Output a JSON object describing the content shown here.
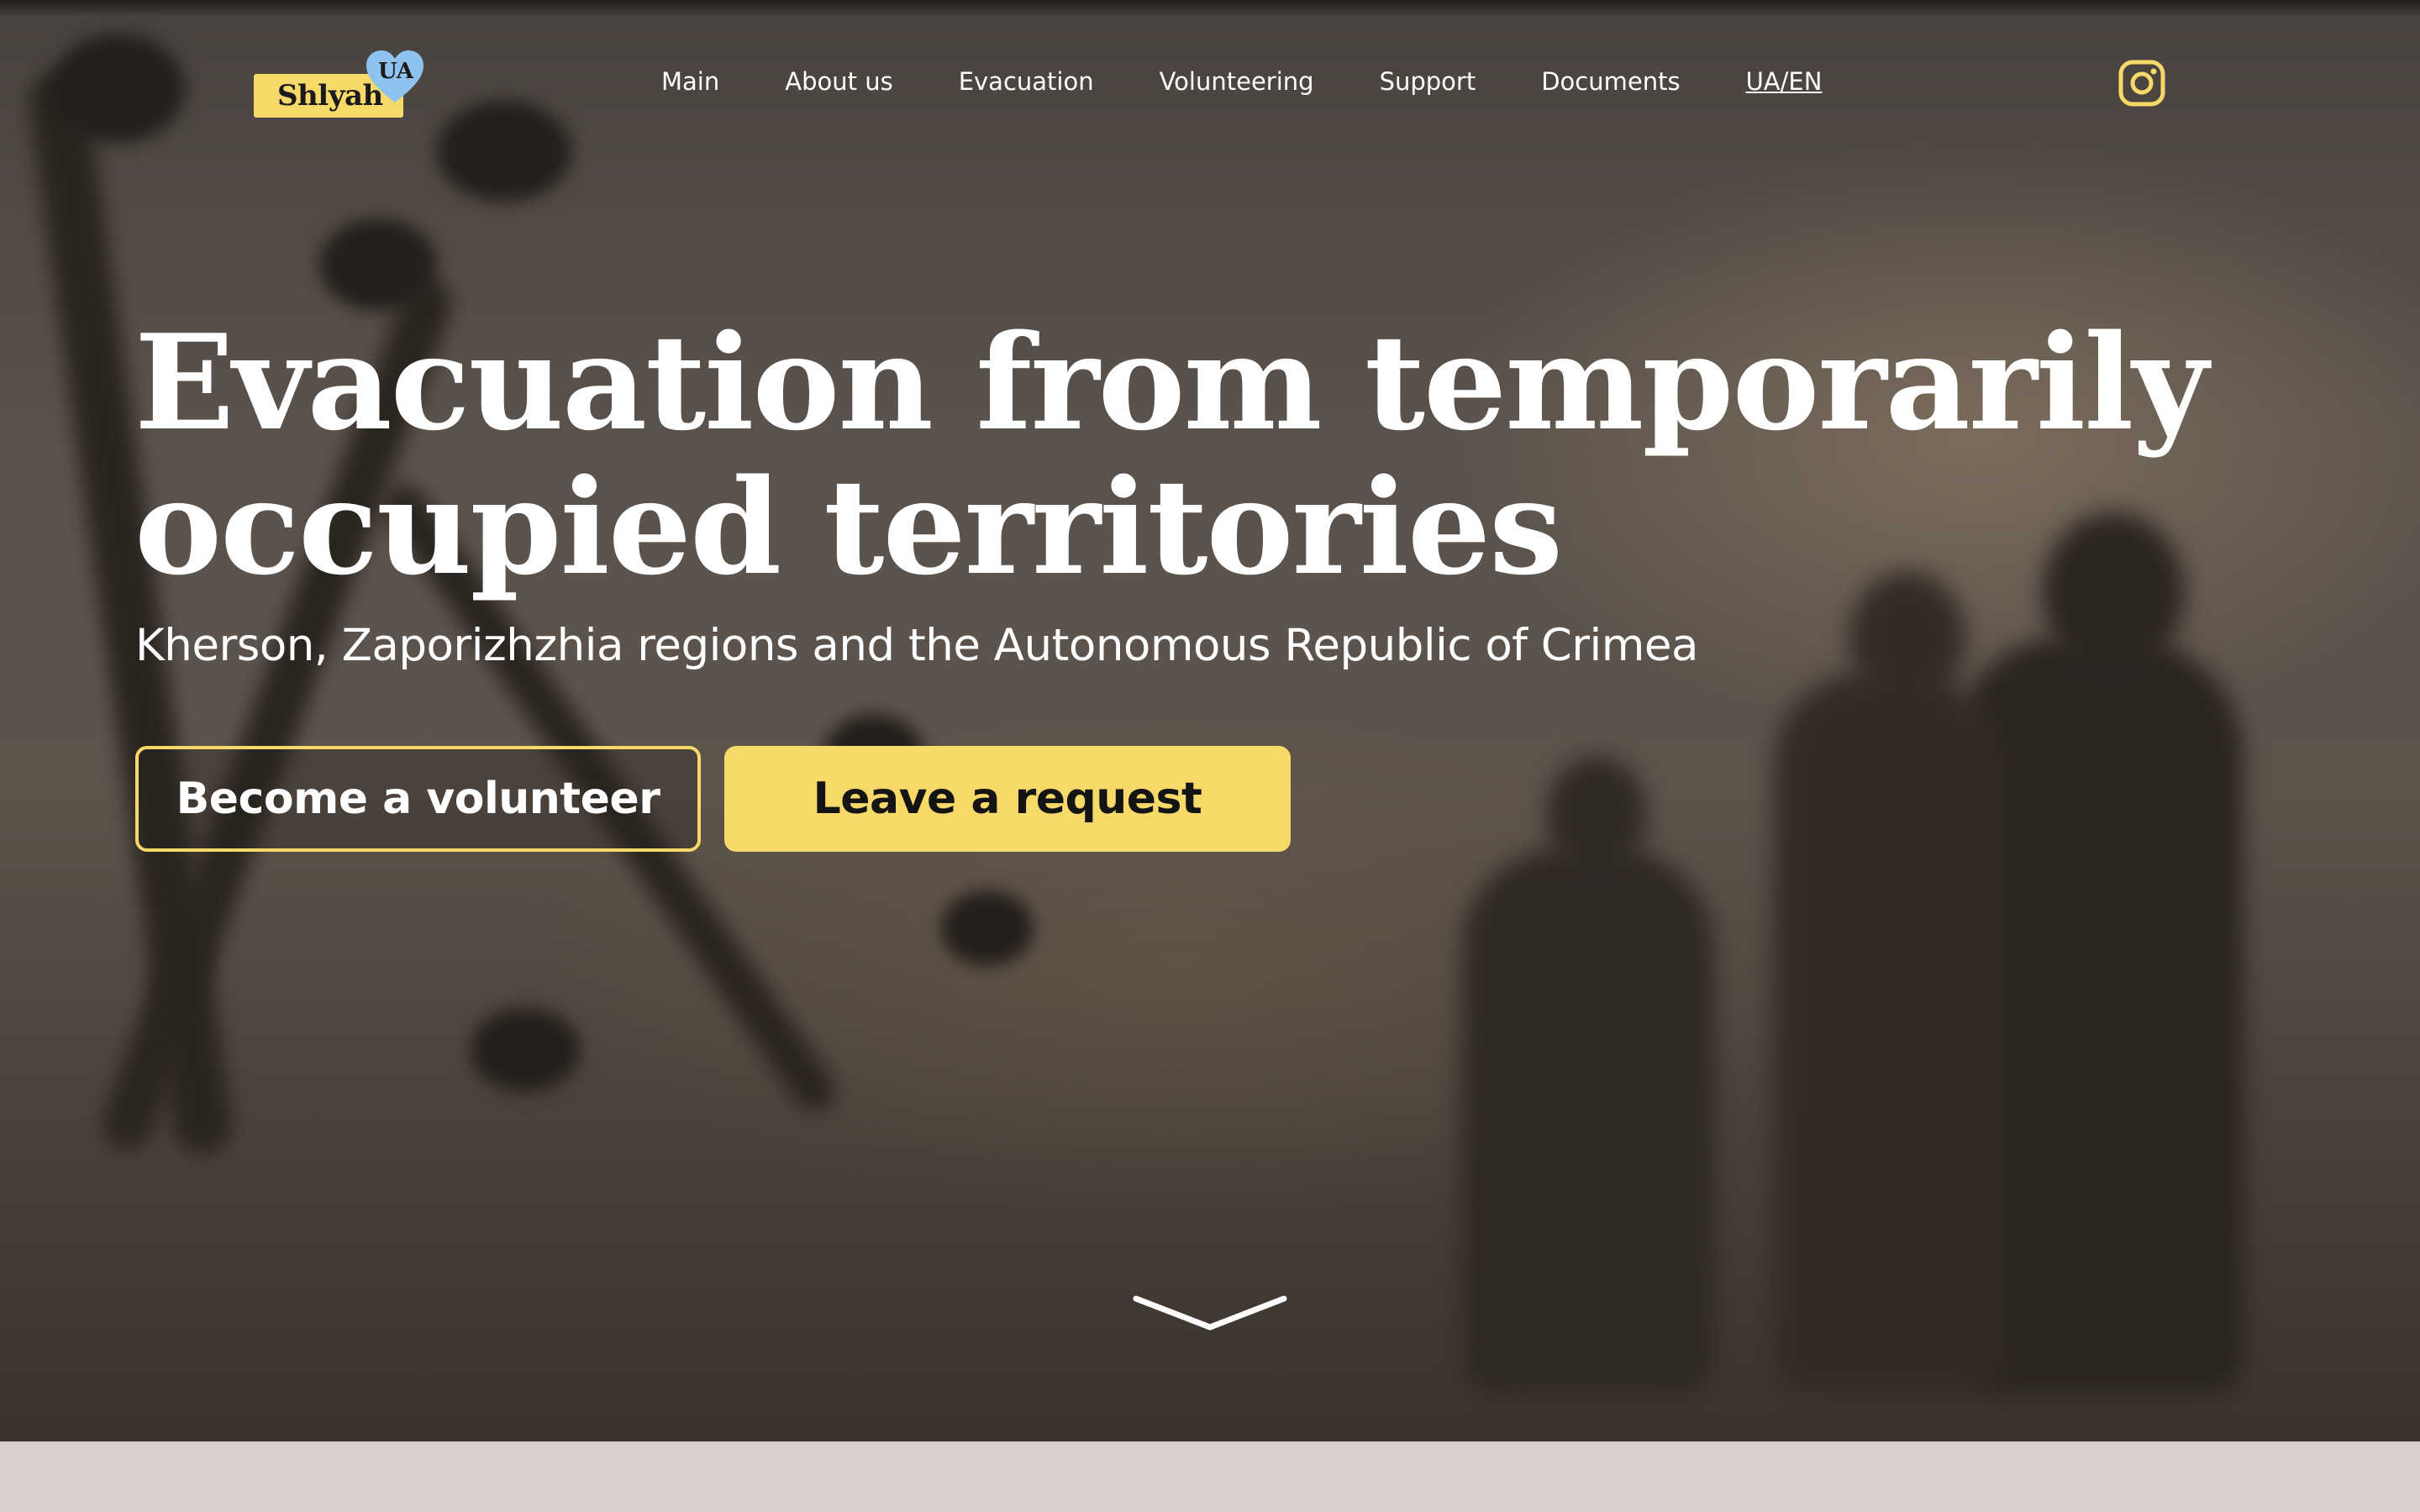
{
  "brand": {
    "name": "Shlyah",
    "badge": "UA",
    "plate_color": "#f7d96a",
    "heart_color": "#8ec3f0"
  },
  "nav": {
    "items": [
      {
        "label": "Main"
      },
      {
        "label": "About us"
      },
      {
        "label": "Evacuation"
      },
      {
        "label": "Volunteering"
      },
      {
        "label": "Support"
      },
      {
        "label": "Documents"
      }
    ],
    "language": "UA/EN"
  },
  "social": {
    "icon": "instagram-icon",
    "color": "#f7d96a"
  },
  "hero": {
    "title_line1": "Evacuation from temporarily",
    "title_line2": "occupied territories",
    "subtitle": "Kherson, Zaporizhzhia regions and the Autonomous Republic of Crimea",
    "volunteer_button": "Become a volunteer",
    "request_button": "Leave a request",
    "scroll_icon": "chevron-down-icon"
  },
  "colors": {
    "accent": "#f7d96a",
    "text": "#ffffff",
    "footer_strip": "#d6cfcc"
  }
}
